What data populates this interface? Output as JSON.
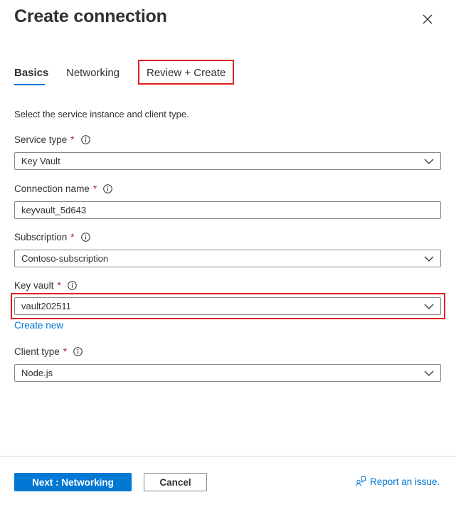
{
  "header": {
    "title": "Create connection"
  },
  "tabs": [
    {
      "label": "Basics"
    },
    {
      "label": "Networking"
    },
    {
      "label": "Review + Create"
    }
  ],
  "intro_text": "Select the service instance and client type.",
  "fields": {
    "service_type": {
      "label": "Service type",
      "required": "*",
      "value": "Key Vault"
    },
    "connection_name": {
      "label": "Connection name",
      "required": "*",
      "value": "keyvault_5d643"
    },
    "subscription": {
      "label": "Subscription",
      "required": "*",
      "value": "Contoso-subscription"
    },
    "key_vault": {
      "label": "Key vault",
      "required": "*",
      "value": "vault202511",
      "create_new_label": "Create new"
    },
    "client_type": {
      "label": "Client type",
      "required": "*",
      "value": "Node.js"
    }
  },
  "footer": {
    "next_label": "Next : Networking",
    "cancel_label": "Cancel",
    "report_label": "Report an issue."
  },
  "icons": {
    "close": "close-icon",
    "info": "info-icon",
    "chevron": "chevron-down-icon",
    "feedback": "feedback-icon"
  },
  "colors": {
    "accent": "#0078d4",
    "highlight": "#e02020",
    "required": "#a4262c"
  }
}
